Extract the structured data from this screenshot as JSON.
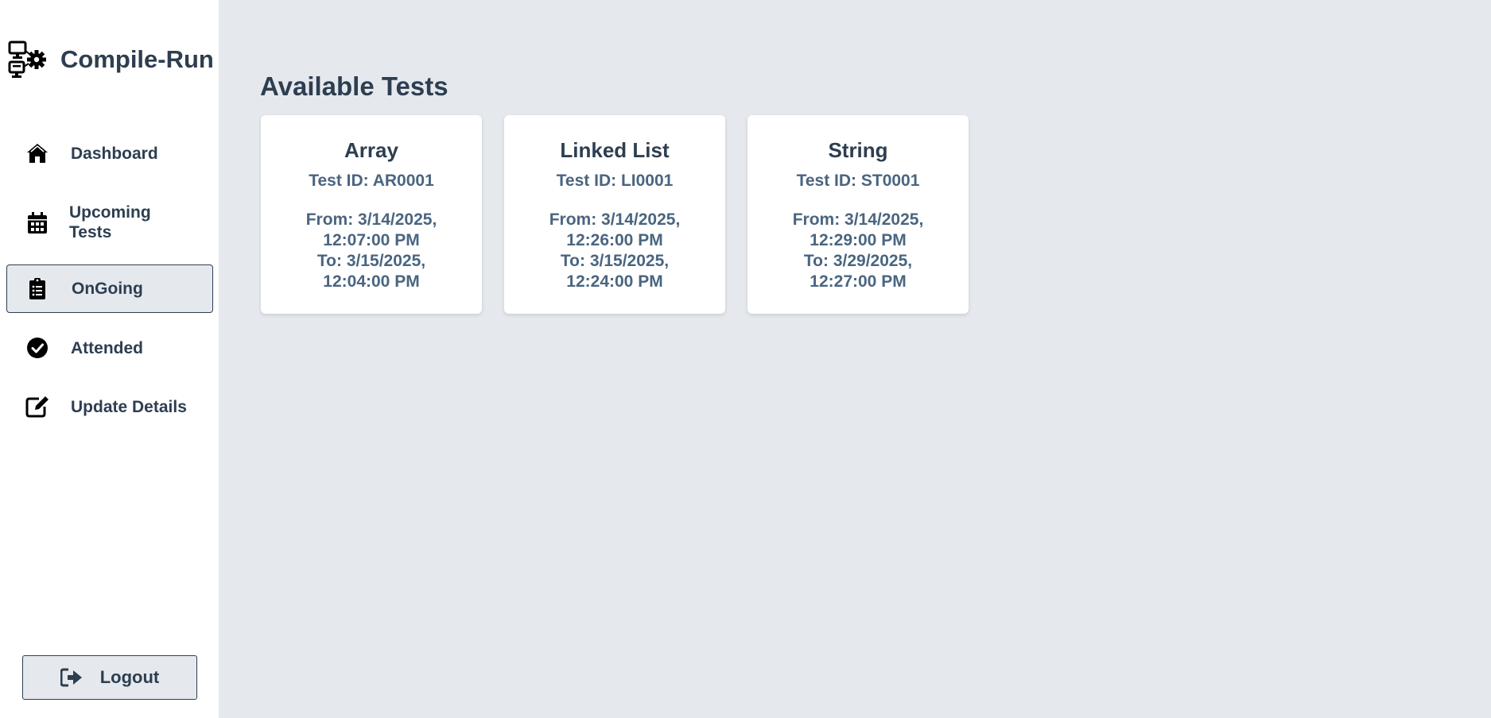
{
  "app": {
    "name": "Compile-Run"
  },
  "sidebar": {
    "items": [
      {
        "label": "Dashboard",
        "icon": "home-icon"
      },
      {
        "label": "Upcoming Tests",
        "icon": "calendar-icon"
      },
      {
        "label": "OnGoing",
        "icon": "clipboard-list-icon",
        "active": true
      },
      {
        "label": "Attended",
        "icon": "check-circle-icon"
      },
      {
        "label": "Update Details",
        "icon": "edit-icon"
      }
    ],
    "logout_label": "Logout"
  },
  "main": {
    "title": "Available Tests",
    "tests": [
      {
        "name": "Array",
        "test_id": "Test ID: AR0001",
        "from": "From: 3/14/2025, 12:07:00 PM",
        "to": "To: 3/15/2025, 12:04:00 PM"
      },
      {
        "name": "Linked List",
        "test_id": "Test ID: LI0001",
        "from": "From: 3/14/2025, 12:26:00 PM",
        "to": "To: 3/15/2025, 12:24:00 PM"
      },
      {
        "name": "String",
        "test_id": "Test ID: ST0001",
        "from": "From: 3/14/2025, 12:29:00 PM",
        "to": "To: 3/29/2025, 12:27:00 PM"
      }
    ]
  },
  "colors": {
    "text_primary": "#2d3e50",
    "text_secondary": "#4a6580",
    "background": "#e5e9ee",
    "surface": "#ffffff"
  }
}
